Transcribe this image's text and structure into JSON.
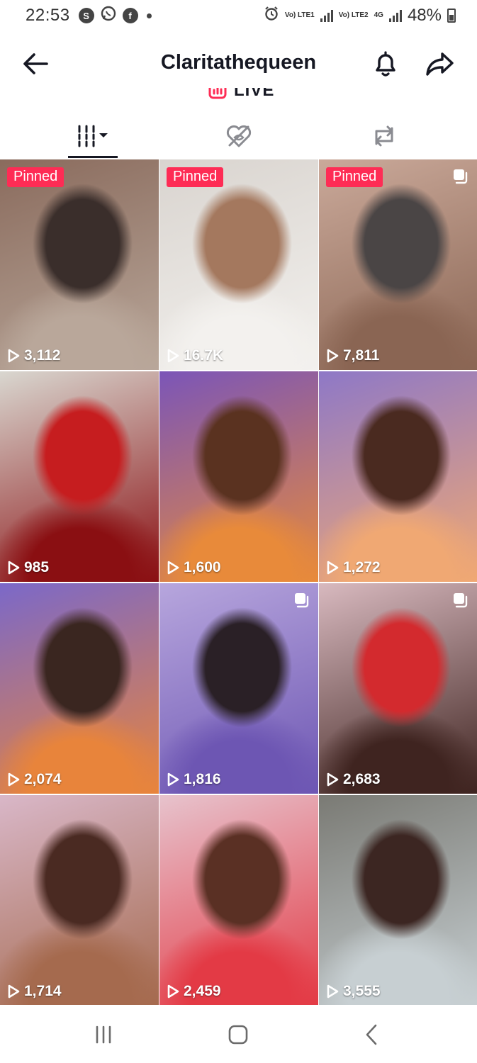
{
  "status_bar": {
    "time": "22:53",
    "notification_icons": [
      "s-app-icon",
      "whatsapp-icon",
      "facebook-icon"
    ],
    "sim1_label": "Vo) LTE1",
    "sim2_label": "Vo) LTE2",
    "network_type": "4G",
    "battery": "48%"
  },
  "header": {
    "title": "Claritathequeen",
    "back_icon": "arrow-left-icon",
    "bell_icon": "bell-icon",
    "share_icon": "share-arrow-icon"
  },
  "live": {
    "label": "LIVE"
  },
  "tabs": [
    {
      "name": "videos",
      "icon": "grid-bars-icon",
      "active": true
    },
    {
      "name": "liked",
      "icon": "heart-hidden-icon",
      "active": false
    },
    {
      "name": "reposts",
      "icon": "repost-icon",
      "active": false
    }
  ],
  "videos": [
    {
      "pinned": "Pinned",
      "views": "3,112",
      "carousel": false,
      "colors": [
        "#8a6b5d",
        "#3a2e2b",
        "#b9a79a"
      ]
    },
    {
      "pinned": "Pinned",
      "views": "16.7K",
      "carousel": false,
      "colors": [
        "#d9d4cf",
        "#a4785e",
        "#f3f1ee"
      ]
    },
    {
      "pinned": "Pinned",
      "views": "7,811",
      "carousel": true,
      "colors": [
        "#caa99a",
        "#4a4545",
        "#8a6553"
      ]
    },
    {
      "pinned": "",
      "views": "985",
      "carousel": false,
      "colors": [
        "#d9d7d0",
        "#c61d1f",
        "#8a0f12"
      ]
    },
    {
      "pinned": "",
      "views": "1,600",
      "carousel": false,
      "colors": [
        "#7b55b8",
        "#5a3220",
        "#e88a3a"
      ]
    },
    {
      "pinned": "",
      "views": "1,272",
      "carousel": false,
      "colors": [
        "#8e78c7",
        "#4a2a20",
        "#f0a873"
      ]
    },
    {
      "pinned": "",
      "views": "2,074",
      "carousel": false,
      "colors": [
        "#7b68c9",
        "#3a2620",
        "#e8843b"
      ]
    },
    {
      "pinned": "",
      "views": "1,816",
      "carousel": true,
      "colors": [
        "#b7a6dd",
        "#2a2026",
        "#6d56b3"
      ]
    },
    {
      "pinned": "",
      "views": "2,683",
      "carousel": true,
      "colors": [
        "#d8b9bf",
        "#d32a2e",
        "#3f2420"
      ]
    },
    {
      "pinned": "",
      "views": "1,714",
      "carousel": false,
      "colors": [
        "#d9b7c8",
        "#4a2a22",
        "#a56a4e"
      ]
    },
    {
      "pinned": "",
      "views": "2,459",
      "carousel": false,
      "colors": [
        "#e7c3cd",
        "#5a3024",
        "#e33a45"
      ]
    },
    {
      "pinned": "",
      "views": "3,555",
      "carousel": false,
      "colors": [
        "#7a7a74",
        "#3c2622",
        "#c7cfd2"
      ]
    }
  ],
  "nav_bar": {
    "recents_icon": "recents-icon",
    "home_icon": "home-icon",
    "back_icon": "back-chevron-icon"
  }
}
